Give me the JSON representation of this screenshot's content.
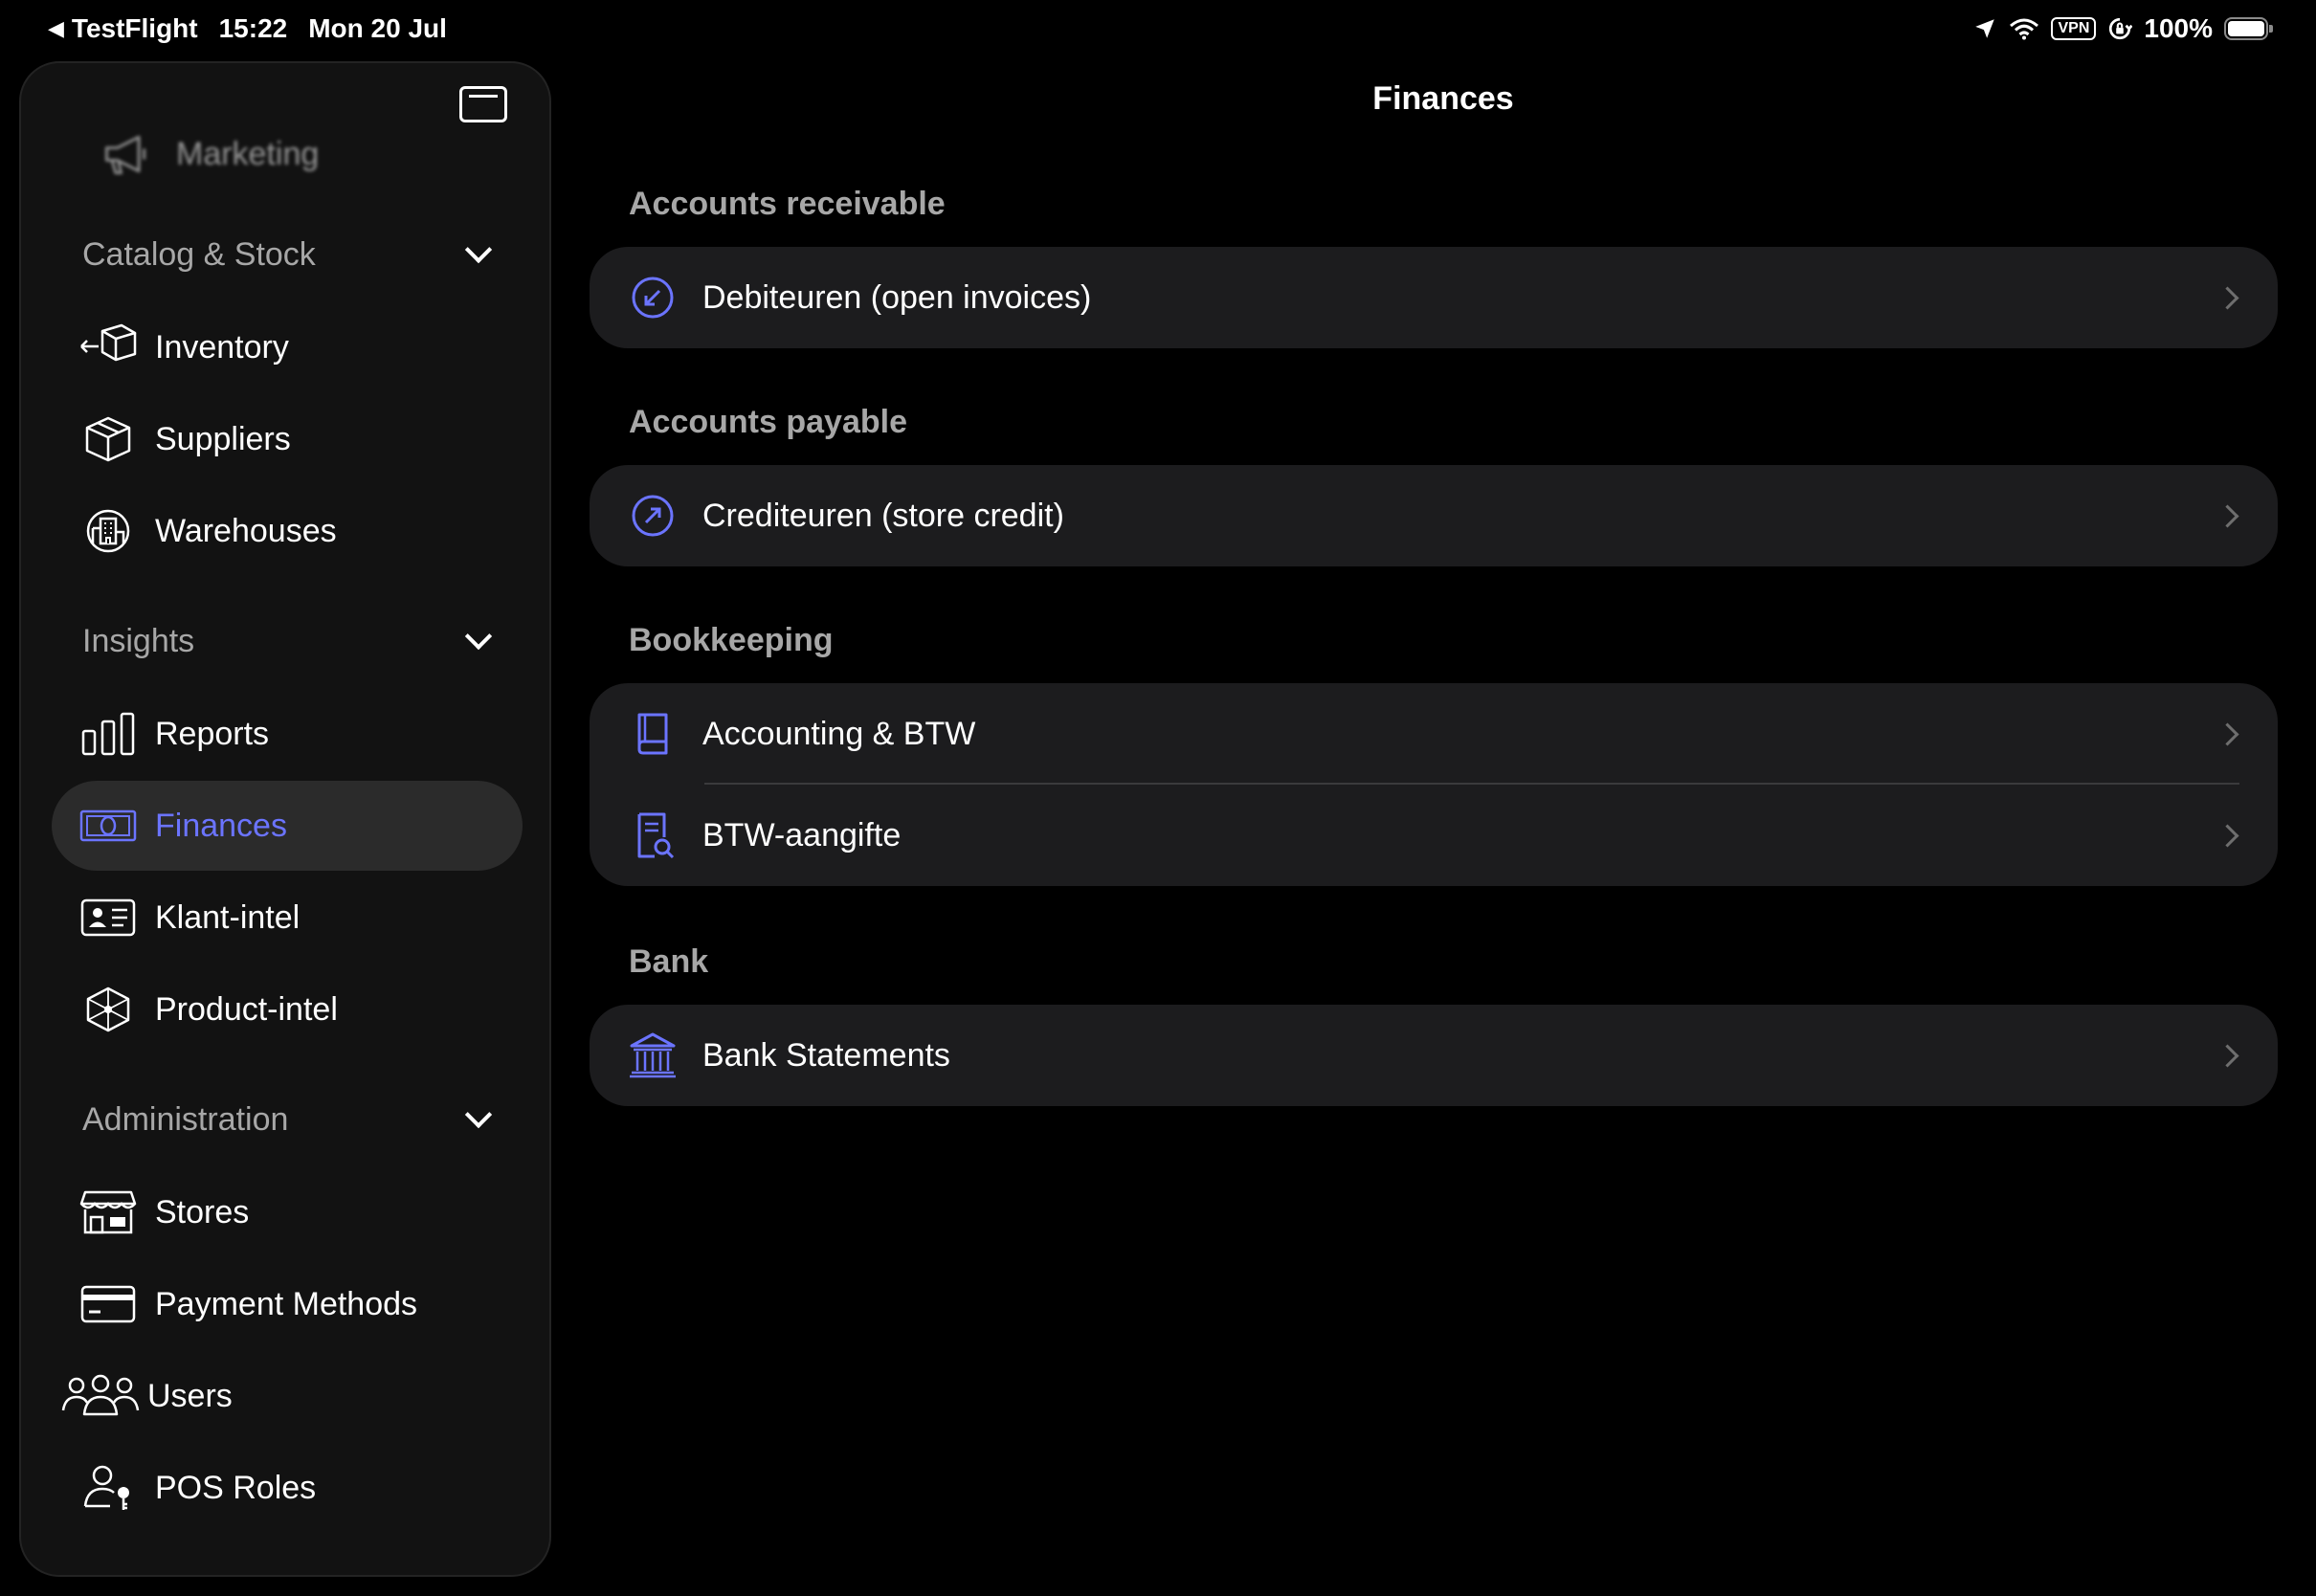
{
  "status_bar": {
    "back_app": "TestFlight",
    "time": "15:22",
    "date": "Mon 20 Jul",
    "vpn": "VPN",
    "battery": "100%"
  },
  "sidebar": {
    "marketing_label": "Marketing",
    "sections": [
      {
        "title": "Catalog & Stock",
        "items": [
          {
            "label": "Inventory",
            "icon": "box-arrow-icon"
          },
          {
            "label": "Suppliers",
            "icon": "cube-icon"
          },
          {
            "label": "Warehouses",
            "icon": "building-icon"
          }
        ]
      },
      {
        "title": "Insights",
        "items": [
          {
            "label": "Reports",
            "icon": "bar-chart-icon"
          },
          {
            "label": "Finances",
            "icon": "banknote-icon",
            "active": true
          },
          {
            "label": "Klant-intel",
            "icon": "person-card-icon"
          },
          {
            "label": "Product-intel",
            "icon": "cube-network-icon"
          }
        ]
      },
      {
        "title": "Administration",
        "items": [
          {
            "label": "Stores",
            "icon": "storefront-icon"
          },
          {
            "label": "Payment Methods",
            "icon": "credit-card-icon"
          },
          {
            "label": "Users",
            "icon": "users-icon"
          },
          {
            "label": "POS Roles",
            "icon": "person-key-icon"
          }
        ]
      }
    ]
  },
  "main": {
    "title": "Finances",
    "groups": [
      {
        "title": "Accounts receivable",
        "rows": [
          {
            "label": "Debiteuren (open invoices)",
            "icon": "arrow-down-left-circle-icon"
          }
        ]
      },
      {
        "title": "Accounts payable",
        "rows": [
          {
            "label": "Crediteuren (store credit)",
            "icon": "arrow-up-right-circle-icon"
          }
        ]
      },
      {
        "title": "Bookkeeping",
        "rows": [
          {
            "label": "Accounting & BTW",
            "icon": "book-icon"
          },
          {
            "label": "BTW-aangifte",
            "icon": "document-search-icon"
          }
        ]
      },
      {
        "title": "Bank",
        "rows": [
          {
            "label": "Bank Statements",
            "icon": "bank-icon"
          }
        ]
      }
    ]
  },
  "colors": {
    "accent": "#6b74ff",
    "background": "#000000",
    "sidebar": "#121212",
    "card": "#1c1c1e",
    "secondary_text": "#a7a7a7"
  }
}
